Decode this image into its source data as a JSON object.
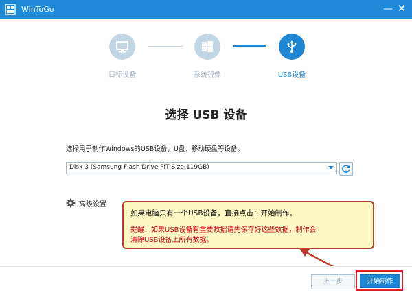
{
  "window": {
    "title": "WinToGo",
    "minimize_symbol": "—",
    "close_symbol": "✕"
  },
  "steps": [
    {
      "label": "目标设备",
      "icon": "monitor-icon",
      "active": false
    },
    {
      "label": "系统镜像",
      "icon": "windows-icon",
      "active": false
    },
    {
      "label": "USB设备",
      "icon": "usb-icon",
      "active": true
    }
  ],
  "main": {
    "heading": "选择 USB 设备",
    "description": "选择用于制作Windows的USB设备，U盘、移动硬盘等设备。",
    "device_select": {
      "selected": "Disk 3 (Samsung Flash Drive FIT  Size:119GB)"
    },
    "advanced_label": "高级设置"
  },
  "callout": {
    "line1": "如果电脑只有一个USB设备，直接点击：开始制作。",
    "line2": "提醒：如果USB设备有重要数据请先保存好这些数据，制作会",
    "line3": "清除USB设备上所有数据。"
  },
  "footer": {
    "prev_label": "上一步",
    "start_label": "开始制作"
  },
  "colors": {
    "accent": "#1e86d3",
    "titlebar": "#1f8bd8",
    "inactive": "#c3d6e4",
    "annotation_red": "#d0021b",
    "callout_bg": "#fdf8c4"
  }
}
